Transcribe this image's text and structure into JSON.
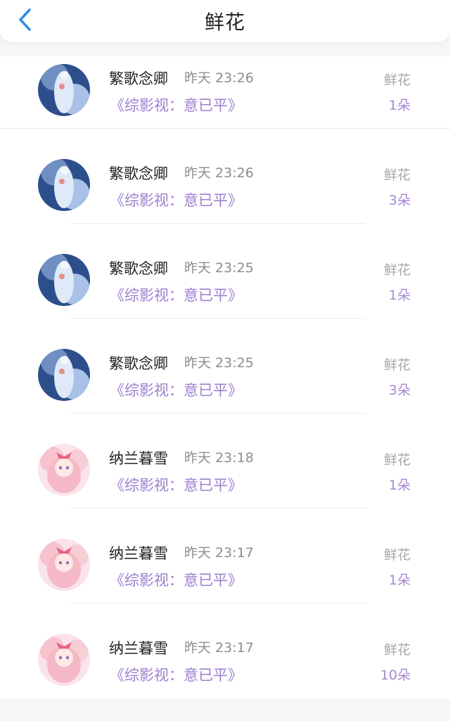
{
  "header": {
    "title": "鲜花"
  },
  "list": {
    "items": [
      {
        "name": "繁歌念卿",
        "time": "昨天 23:26",
        "book": "《综影视：意已平》",
        "gift": "鲜花",
        "count": "1朵",
        "avatar": "blue-portrait-avatar"
      },
      {
        "name": "繁歌念卿",
        "time": "昨天 23:26",
        "book": "《综影视：意已平》",
        "gift": "鲜花",
        "count": "3朵",
        "avatar": "blue-portrait-avatar"
      },
      {
        "name": "繁歌念卿",
        "time": "昨天 23:25",
        "book": "《综影视：意已平》",
        "gift": "鲜花",
        "count": "1朵",
        "avatar": "blue-portrait-avatar"
      },
      {
        "name": "繁歌念卿",
        "time": "昨天 23:25",
        "book": "《综影视：意已平》",
        "gift": "鲜花",
        "count": "3朵",
        "avatar": "blue-portrait-avatar"
      },
      {
        "name": "纳兰暮雪",
        "time": "昨天 23:18",
        "book": "《综影视：意已平》",
        "gift": "鲜花",
        "count": "1朵",
        "avatar": "pink-portrait-avatar"
      },
      {
        "name": "纳兰暮雪",
        "time": "昨天 23:17",
        "book": "《综影视：意已平》",
        "gift": "鲜花",
        "count": "1朵",
        "avatar": "pink-portrait-avatar"
      },
      {
        "name": "纳兰暮雪",
        "time": "昨天 23:17",
        "book": "《综影视：意已平》",
        "gift": "鲜花",
        "count": "10朵",
        "avatar": "pink-portrait-avatar"
      }
    ]
  }
}
